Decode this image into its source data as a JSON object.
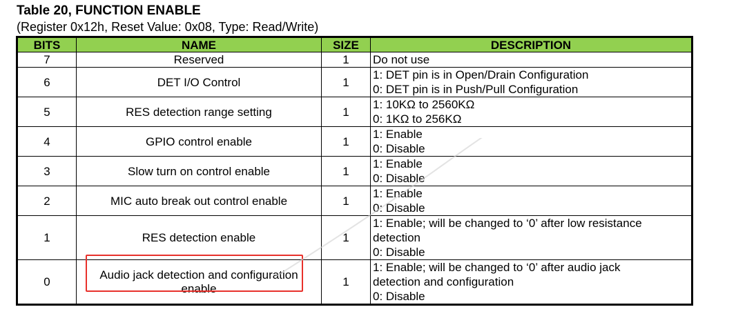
{
  "title": "Table 20, FUNCTION ENABLE",
  "subtitle": "(Register 0x12h, Reset Value: 0x08, Type: Read/Write)",
  "headers": {
    "bits": "BITS",
    "name": "NAME",
    "size": "SIZE",
    "description": "DESCRIPTION"
  },
  "rows": [
    {
      "bits": "7",
      "name": "Reserved",
      "size": "1",
      "desc": [
        "Do not use"
      ]
    },
    {
      "bits": "6",
      "name": "DET I/O Control",
      "size": "1",
      "desc": [
        "1: DET pin is in Open/Drain Configuration",
        "0: DET pin is in Push/Pull Configuration"
      ]
    },
    {
      "bits": "5",
      "name": "RES detection range setting",
      "size": "1",
      "desc": [
        "1: 10KΩ to 2560KΩ",
        "0: 1KΩ to 256KΩ"
      ]
    },
    {
      "bits": "4",
      "name": "GPIO control enable",
      "size": "1",
      "desc": [
        "1: Enable",
        "0: Disable"
      ]
    },
    {
      "bits": "3",
      "name": "Slow turn on control enable",
      "size": "1",
      "desc": [
        "1: Enable",
        "0: Disable"
      ]
    },
    {
      "bits": "2",
      "name": "MIC auto break out control enable",
      "size": "1",
      "desc": [
        "1: Enable",
        "0: Disable"
      ]
    },
    {
      "bits": "1",
      "name": "RES detection enable",
      "size": "1",
      "desc": [
        "1: Enable; will be changed to ‘0’ after low resistance",
        "detection",
        "0: Disable"
      ]
    },
    {
      "bits": "0",
      "name": "Audio jack detection and configuration enable",
      "size": "1",
      "desc": [
        "1: Enable; will be changed to ‘0’ after audio jack",
        "detection and configuration",
        "0: Disable"
      ]
    }
  ],
  "colors": {
    "header_bg": "#92d050",
    "highlight_border": "#e8302a",
    "watermark": "#c8c8c8"
  }
}
